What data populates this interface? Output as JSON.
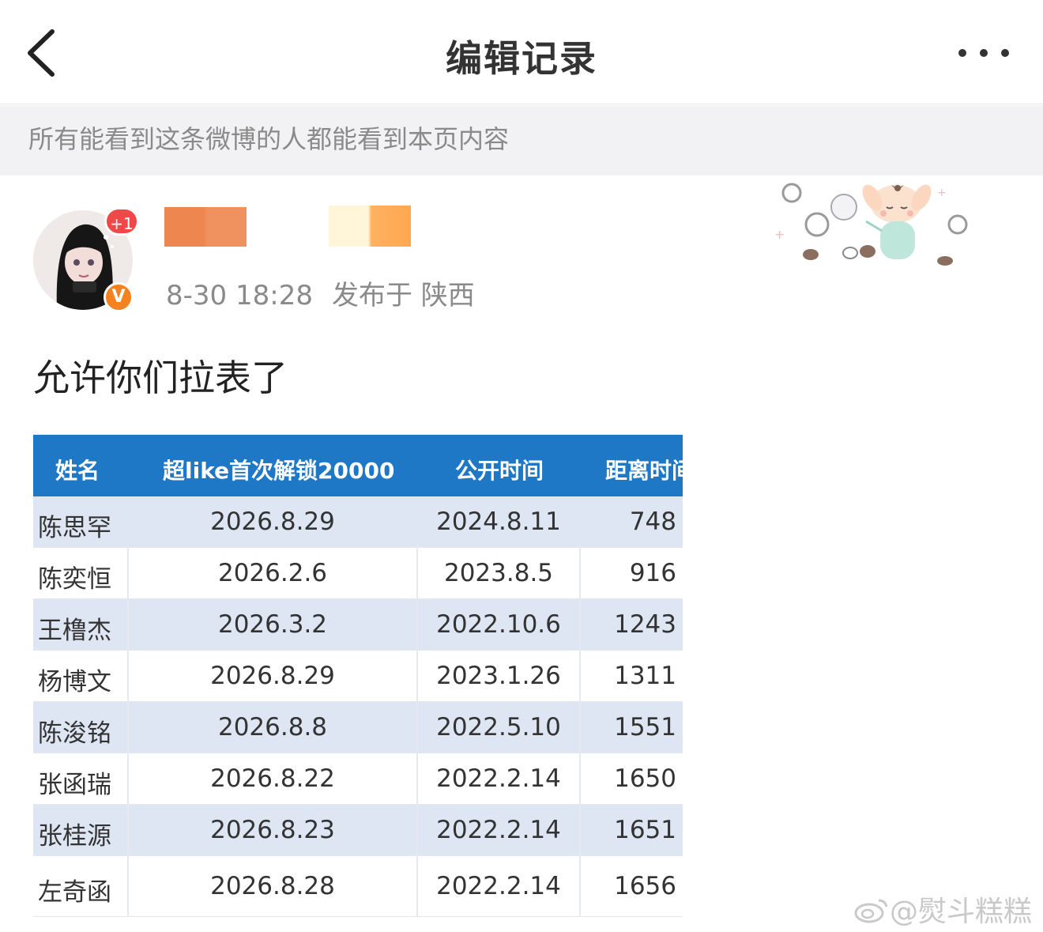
{
  "header": {
    "title": "编辑记录"
  },
  "notice": {
    "text": "所有能看到这条微博的人都能看到本页内容"
  },
  "post": {
    "avatar_badge": "+1",
    "verified_label": "V",
    "time": "8-30 18:28",
    "location": "发布于 陕西",
    "text": "允许你们拉表了"
  },
  "table": {
    "headers": [
      "姓名",
      "超like首次解锁20000",
      "公开时间",
      "距离时间"
    ],
    "rows": [
      [
        "陈思罕",
        "2026.8.29",
        "2024.8.11",
        "748"
      ],
      [
        "陈奕恒",
        "2026.2.6",
        "2023.8.5",
        "916"
      ],
      [
        "王橹杰",
        "2026.3.2",
        "2022.10.6",
        "1243"
      ],
      [
        "杨博文",
        "2026.8.29",
        "2023.1.26",
        "1311"
      ],
      [
        "陈浚铭",
        "2026.8.8",
        "2022.5.10",
        "1551"
      ],
      [
        "张函瑞",
        "2026.8.22",
        "2022.2.14",
        "1650"
      ],
      [
        "张桂源",
        "2026.8.23",
        "2022.2.14",
        "1651"
      ],
      [
        "左奇函",
        "2026.8.28",
        "2022.2.14",
        "1656"
      ]
    ]
  },
  "watermark": {
    "text": "@熨斗糕糕"
  },
  "colors": {
    "table_header": "#1f78c6",
    "table_alt_row": "#dde6f2",
    "verified": "#f58220",
    "badge": "#f04848"
  }
}
